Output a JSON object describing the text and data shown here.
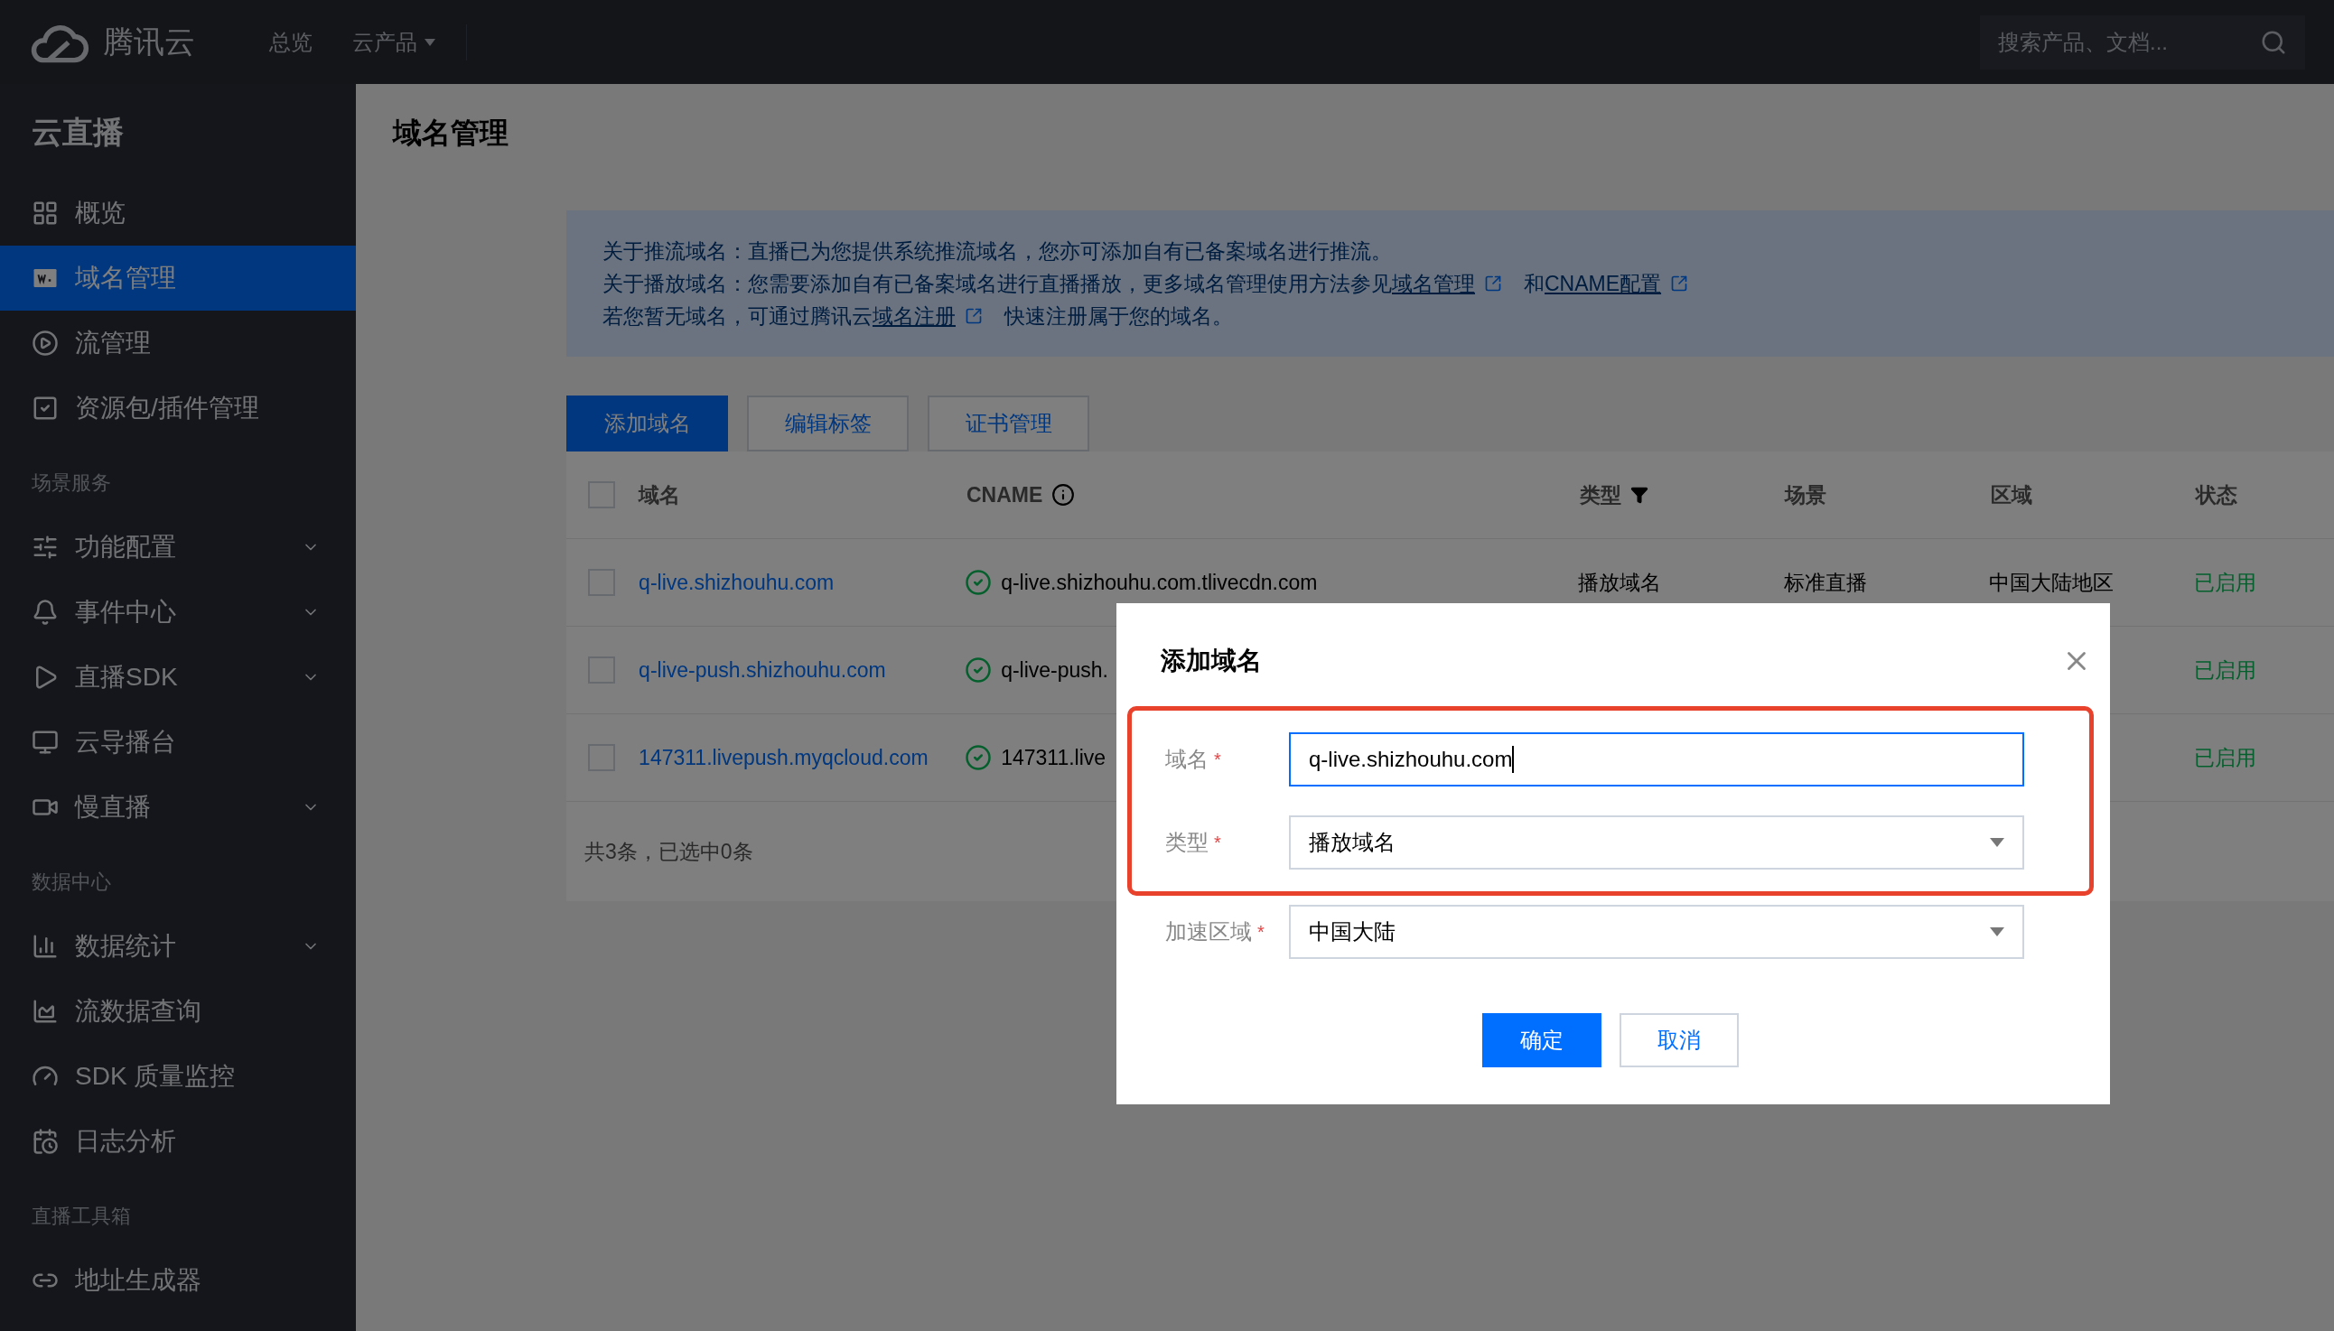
{
  "topbar": {
    "brand": "腾讯云",
    "nav": [
      {
        "label": "总览",
        "dropdown": false
      },
      {
        "label": "云产品",
        "dropdown": true
      }
    ],
    "search": {
      "placeholder": "搜索产品、文档..."
    }
  },
  "sidebar": {
    "title": "云直播",
    "sections": [
      {
        "items": [
          {
            "label": "概览",
            "selected": false,
            "kind": "link"
          },
          {
            "label": "域名管理",
            "selected": true,
            "kind": "link"
          },
          {
            "label": "流管理",
            "selected": false,
            "kind": "link"
          },
          {
            "label": "资源包/插件管理",
            "selected": false,
            "kind": "link"
          }
        ]
      },
      {
        "heading": "场景服务",
        "items": [
          {
            "label": "功能配置",
            "selected": false,
            "kind": "group"
          },
          {
            "label": "事件中心",
            "selected": false,
            "kind": "group"
          },
          {
            "label": "直播SDK",
            "selected": false,
            "kind": "group"
          },
          {
            "label": "云导播台",
            "selected": false,
            "kind": "link"
          },
          {
            "label": "慢直播",
            "selected": false,
            "kind": "group"
          }
        ]
      },
      {
        "heading": "数据中心",
        "items": [
          {
            "label": "数据统计",
            "selected": false,
            "kind": "group"
          },
          {
            "label": "流数据查询",
            "selected": false,
            "kind": "link"
          },
          {
            "label": "SDK 质量监控",
            "selected": false,
            "kind": "link"
          },
          {
            "label": "日志分析",
            "selected": false,
            "kind": "link"
          }
        ]
      },
      {
        "heading": "直播工具箱",
        "items": [
          {
            "label": "地址生成器",
            "selected": false,
            "kind": "link"
          }
        ]
      }
    ]
  },
  "page": {
    "title": "域名管理"
  },
  "notice": {
    "lines": [
      [
        {
          "kind": "text",
          "text": "关于推流域名：直播已为您提供系统推流域名，您亦可添加自有已备案域名进行推流。"
        }
      ],
      [
        {
          "kind": "text",
          "text": "关于播放域名：您需要添加自有已备案域名进行直播播放，更多域名管理使用方法参见"
        },
        {
          "kind": "link",
          "text": "域名管理"
        },
        {
          "kind": "text",
          "text": "和"
        },
        {
          "kind": "link",
          "text": "CNAME配置"
        }
      ],
      [
        {
          "kind": "text",
          "text": "若您暂无域名，可通过腾讯云"
        },
        {
          "kind": "link",
          "text": "域名注册"
        },
        {
          "kind": "text",
          "text": "快速注册属于您的域名。"
        }
      ]
    ]
  },
  "toolbar": [
    {
      "label": "添加域名",
      "kind": "primary"
    },
    {
      "label": "编辑标签",
      "kind": "secondary"
    },
    {
      "label": "证书管理",
      "kind": "secondary"
    }
  ],
  "table": {
    "all_checked": false,
    "columns": [
      {
        "label": "域名",
        "kind": "plain"
      },
      {
        "label": "CNAME",
        "kind": "info"
      },
      {
        "label": "类型",
        "kind": "filter"
      },
      {
        "label": "场景",
        "kind": "plain"
      },
      {
        "label": "区域",
        "kind": "plain"
      },
      {
        "label": "状态",
        "kind": "plain"
      }
    ],
    "rows": [
      {
        "checked": false,
        "domain": "q-live.shizhouhu.com",
        "cname": "q-live.shizhouhu.com.tlivecdn.com",
        "type": "播放域名",
        "scene": "标准直播",
        "region": "中国大陆地区",
        "status": "已启用"
      },
      {
        "checked": false,
        "domain": "q-live-push.shizhouhu.com",
        "cname": "q-live-push.",
        "status": "已启用"
      },
      {
        "checked": false,
        "domain": "147311.livepush.myqcloud.com",
        "cname": "147311.live",
        "status": "已启用"
      }
    ],
    "footer": "共3条，已选中0条"
  },
  "dialog": {
    "title": "添加域名",
    "fields": [
      {
        "label": "域名",
        "required_mark": "*",
        "kind": "input",
        "value": "q-live.shizhouhu.com",
        "focused": true,
        "highlighted": true
      },
      {
        "label": "类型",
        "required_mark": "*",
        "kind": "select",
        "value": "播放域名",
        "focused": false,
        "highlighted": true
      },
      {
        "label": "加速区域",
        "required_mark": "*",
        "kind": "select",
        "value": "中国大陆",
        "focused": false,
        "highlighted": false
      }
    ],
    "buttons": [
      {
        "label": "确定",
        "kind": "primary"
      },
      {
        "label": "取消",
        "kind": "secondary"
      }
    ]
  }
}
